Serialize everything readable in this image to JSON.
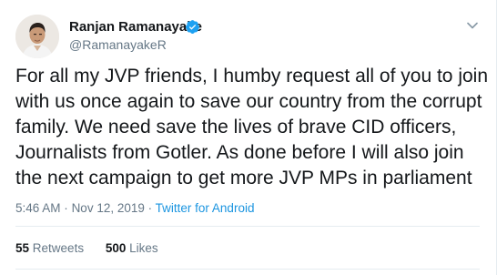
{
  "author": {
    "name": "Ranjan Ramanayake",
    "handle": "@RamanayakeR",
    "verified": true
  },
  "tweet": {
    "text": "For all my JVP friends, I humby request all of you to join\nwith us once again to save our country from the corrupt\nfamily. We need save the lives of brave CID officers,\nJournalists from Gotler. As done before I will also join\nthe next campaign to get more JVP MPs in parliament",
    "time": "5:46 AM",
    "date": "Nov 12, 2019",
    "separator": "·",
    "source": "Twitter for Android"
  },
  "stats": {
    "retweets_count": "55",
    "retweets_label": "Retweets",
    "likes_count": "500",
    "likes_label": "Likes"
  },
  "colors": {
    "verified": "#1da1f2",
    "link": "#1b95e0",
    "secondary_text": "#657786"
  },
  "icons": {
    "verified": "verified-badge-icon",
    "more": "chevron-down-icon"
  }
}
